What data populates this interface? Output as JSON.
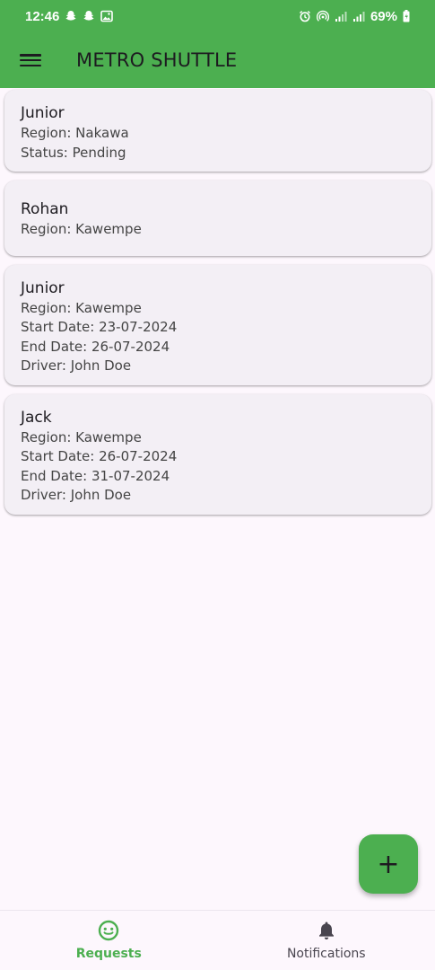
{
  "status_bar": {
    "time": "12:46",
    "battery": "69%"
  },
  "app_bar": {
    "title": "METRO SHUTTLE"
  },
  "requests": [
    {
      "name": "Junior",
      "lines": [
        "Region: Nakawa",
        "Status: Pending"
      ]
    },
    {
      "name": "Rohan",
      "lines": [
        "Region: Kawempe"
      ]
    },
    {
      "name": "Junior",
      "lines": [
        "Region: Kawempe",
        "Start Date: 23-07-2024",
        "End Date: 26-07-2024",
        "Driver: John Doe"
      ]
    },
    {
      "name": "Jack",
      "lines": [
        "Region: Kawempe",
        "Start Date: 26-07-2024",
        "End Date: 31-07-2024",
        "Driver: John Doe"
      ]
    }
  ],
  "fab": {
    "label": "+"
  },
  "bottom_nav": [
    {
      "label": "Requests",
      "icon": "face-icon",
      "active": true
    },
    {
      "label": "Notifications",
      "icon": "bell-icon",
      "active": false
    }
  ],
  "colors": {
    "primary": "#4caf50",
    "background": "#fdf7fd",
    "card": "#f3eff5"
  }
}
